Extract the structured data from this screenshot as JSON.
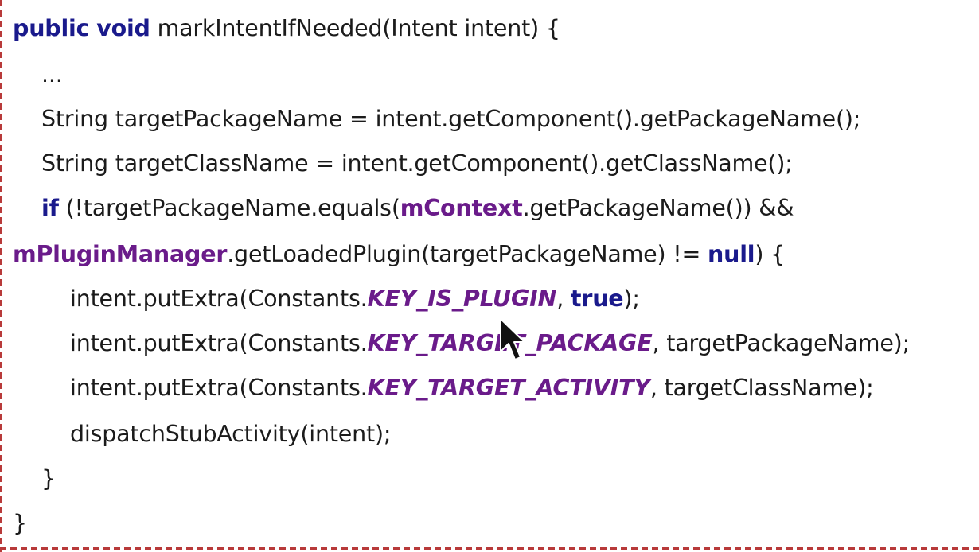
{
  "code": {
    "line1": {
      "kw_public": "public",
      "kw_void": "void",
      "rest": " markIntentIfNeeded(Intent intent) {"
    },
    "line2": {
      "text": "..."
    },
    "line3": {
      "text": "String targetPackageName = intent.getComponent().getPackageName();"
    },
    "line4": {
      "text": "String targetClassName = intent.getComponent().getClassName();"
    },
    "line5": {
      "kw_if": "if",
      "part1": " (!targetPackageName.equals(",
      "field": "mContext",
      "part2": ".getPackageName()) &&"
    },
    "line6": {
      "field": "mPluginManager",
      "part1": ".getLoadedPlugin(targetPackageName) != ",
      "kw_null": "null",
      "part2": ") {"
    },
    "line7": {
      "part1": "intent.putExtra(Constants.",
      "const": "KEY_IS_PLUGIN",
      "part2": ", ",
      "kw_true": "true",
      "part3": ");"
    },
    "line8": {
      "part1": "intent.putExtra(Constants.",
      "const": "KEY_TARGET_PACKAGE",
      "part2": ", targetPackageName);"
    },
    "line9": {
      "part1": "intent.putExtra(Constants.",
      "const": "KEY_TARGET_ACTIVITY",
      "part2": ", targetClassName);"
    },
    "line10": {
      "text": "dispatchStubActivity(intent);"
    },
    "line11": {
      "text": "}"
    },
    "line12": {
      "text": "}"
    }
  },
  "cursor_icon": "mouse-pointer-icon",
  "colors": {
    "keyword": "#1a1a8c",
    "field": "#6a1b8a",
    "text": "#1b1b1b",
    "border": "#b83a3a"
  }
}
